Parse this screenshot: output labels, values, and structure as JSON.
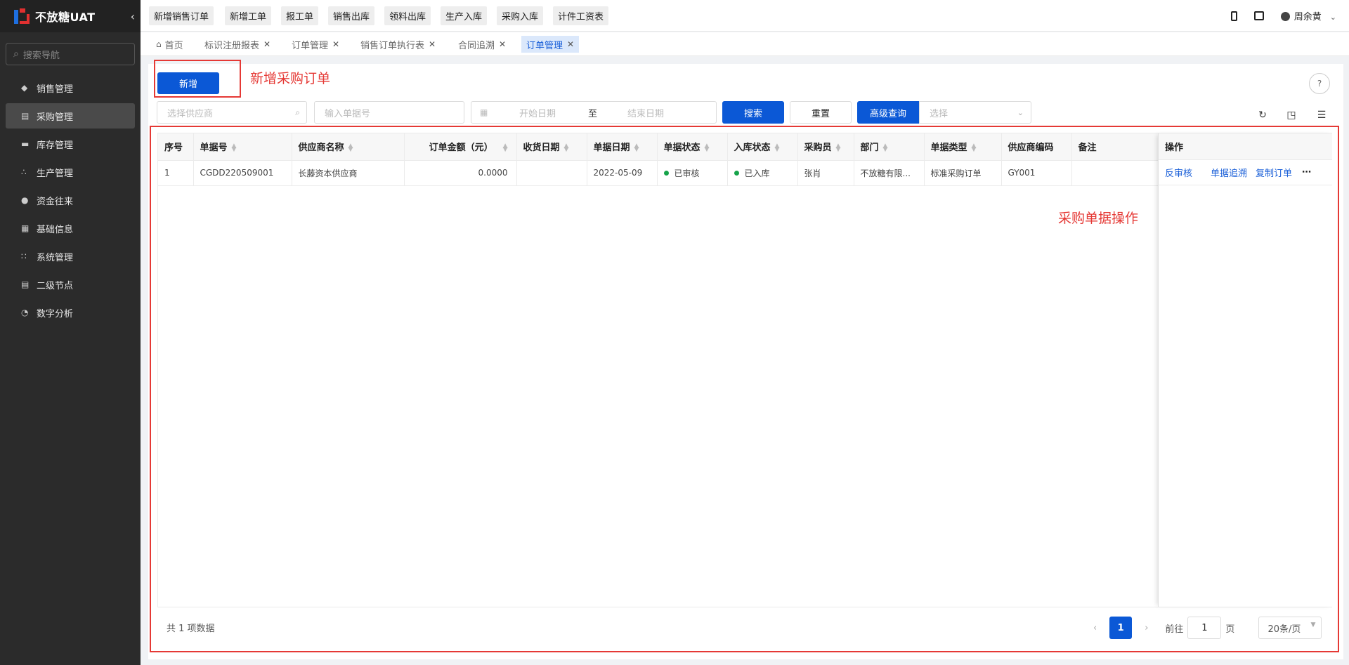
{
  "app": {
    "title": "不放糖UAT"
  },
  "sidebar": {
    "search_placeholder": "搜索导航",
    "items": [
      {
        "label": "销售管理",
        "icon": "tag-icon"
      },
      {
        "label": "采购管理",
        "icon": "cart-icon",
        "active": true
      },
      {
        "label": "库存管理",
        "icon": "warehouse-icon"
      },
      {
        "label": "生产管理",
        "icon": "production-icon"
      },
      {
        "label": "资金往来",
        "icon": "money-icon"
      },
      {
        "label": "基础信息",
        "icon": "grid-icon"
      },
      {
        "label": "系统管理",
        "icon": "apps-icon"
      },
      {
        "label": "二级节点",
        "icon": "document-icon"
      },
      {
        "label": "数字分析",
        "icon": "pie-icon"
      }
    ]
  },
  "quick_menu": [
    "新增销售订单",
    "新增工单",
    "报工单",
    "销售出库",
    "领料出库",
    "生产入库",
    "采购入库",
    "计件工资表"
  ],
  "user": {
    "name": "周余黄"
  },
  "tabs": [
    {
      "label": "首页",
      "closable": false
    },
    {
      "label": "标识注册报表",
      "closable": true
    },
    {
      "label": "订单管理",
      "closable": true
    },
    {
      "label": "销售订单执行表",
      "closable": true
    },
    {
      "label": "合同追溯",
      "closable": true
    },
    {
      "label": "订单管理",
      "closable": true,
      "active": true
    }
  ],
  "toolbar": {
    "new_label": "新增",
    "annotation_new": "新增采购订单",
    "supplier_placeholder": "选择供应商",
    "order_no_placeholder": "输入单据号",
    "start_date_placeholder": "开始日期",
    "date_separator": "至",
    "end_date_placeholder": "结束日期",
    "search_label": "搜索",
    "reset_label": "重置",
    "advanced_label": "高级查询",
    "select_placeholder": "选择"
  },
  "table": {
    "columns": [
      "序号",
      "单据号",
      "供应商名称",
      "订单金额（元）",
      "收货日期",
      "单据日期",
      "单据状态",
      "入库状态",
      "采购员",
      "部门",
      "单据类型",
      "供应商编码",
      "备注"
    ],
    "sortable": [
      false,
      true,
      true,
      true,
      true,
      true,
      true,
      true,
      true,
      true,
      true,
      false,
      false
    ],
    "rows": [
      [
        "1",
        "CGDD220509001",
        "长藤资本供应商",
        "0.0000",
        "",
        "2022-05-09",
        "已审核",
        "已入库",
        "张肖",
        "不放糖有限...",
        "标准采购订单",
        "GY001",
        ""
      ]
    ],
    "ops_header": "操作",
    "row_actions": [
      "反审核",
      "单据追溯",
      "复制订单"
    ],
    "annotation_ops": "采购单据操作"
  },
  "pagination": {
    "total_text": "共 1 项数据",
    "current_page": "1",
    "goto_label": "前往",
    "goto_value": "1",
    "page_unit": "页",
    "page_size": "20条/页"
  }
}
